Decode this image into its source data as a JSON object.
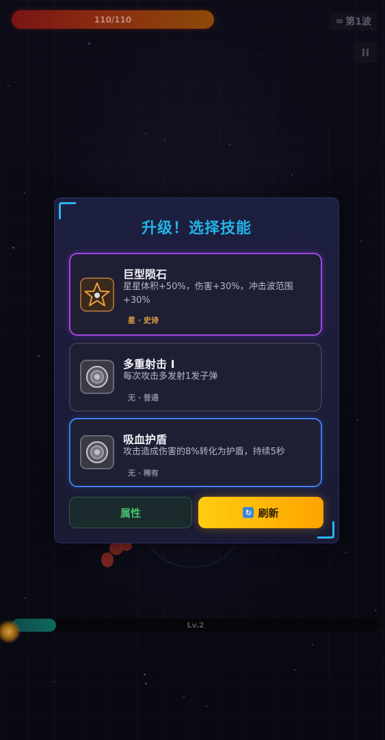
{
  "hud": {
    "hp_text": "110/110",
    "hp_fraction": 1.0,
    "wave_icon": "∞",
    "wave_label": "第1波",
    "pause_icon": "pause-icon",
    "level_label": "Lv.2",
    "exp_fraction": 0.12
  },
  "modal": {
    "title": "升级！选择技能",
    "cards": [
      {
        "name": "巨型陨石",
        "description": "星星体积+50%，伤害+30%，冲击波范围+30%",
        "tag": "星 · 史诗",
        "rarity": "epic",
        "icon": "star-icon",
        "border_color": "#a445e6"
      },
      {
        "name": "多重射击 I",
        "description": "每次攻击多发射1发子弹",
        "tag": "无 · 普通",
        "rarity": "common",
        "icon": "orb-icon",
        "border_color": "#3b3b4a"
      },
      {
        "name": "吸血护盾",
        "description": "攻击造成伤害的8%转化为护盾，持续5秒",
        "tag": "无 · 稀有",
        "rarity": "rare",
        "icon": "orb-icon",
        "border_color": "#3f7ef0"
      }
    ],
    "attributes_button": "属性",
    "refresh_button": "刷新",
    "refresh_icon": "🔄"
  },
  "colors": {
    "title": "#22b4e8",
    "accent_gold": "#ffa400",
    "attr_green": "#46c070"
  }
}
